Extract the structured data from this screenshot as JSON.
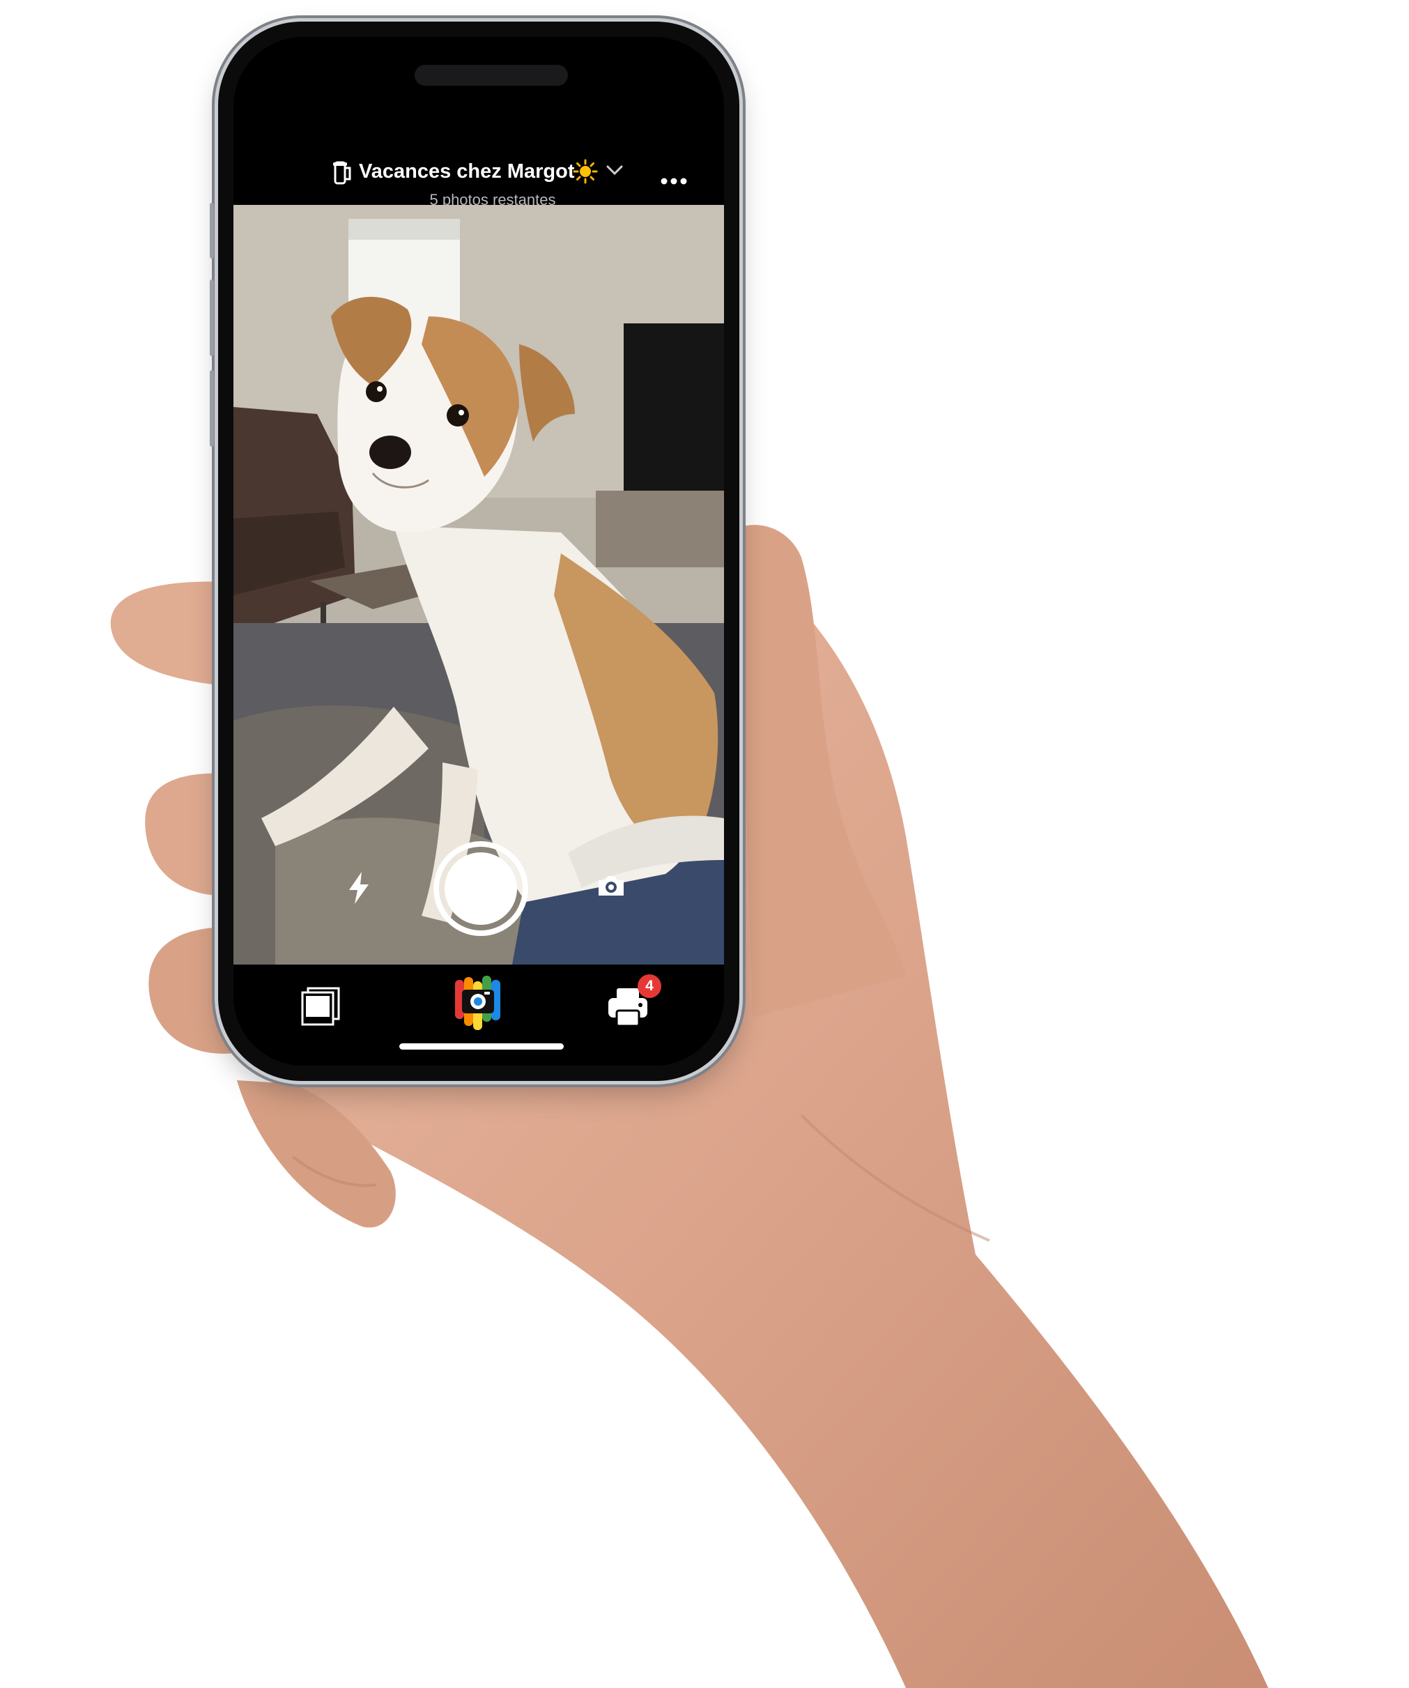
{
  "album": {
    "title": "Vacances chez Margot",
    "title_emoji_icon": "sun-icon",
    "remaining": "5 photos restantes"
  },
  "icons": {
    "film": "film-roll-icon",
    "dropdown": "chevron-down-icon",
    "more": "more-dots-icon",
    "flash": "flash-icon",
    "switch_camera": "camera-switch-icon",
    "photos": "photos-stack-icon",
    "app": "app-logo-camera",
    "print": "printer-icon"
  },
  "print_queue": {
    "badge_count": "4"
  },
  "colors": {
    "background": "#ffffff",
    "phone_frame": "#0b0b0c",
    "ui_text": "#ffffff",
    "subtitle_text": "#b8b8b8",
    "badge": "#e53935",
    "logo_stripes": [
      "#e53935",
      "#fb8c00",
      "#fdd835",
      "#43a047",
      "#1e88e5"
    ]
  }
}
